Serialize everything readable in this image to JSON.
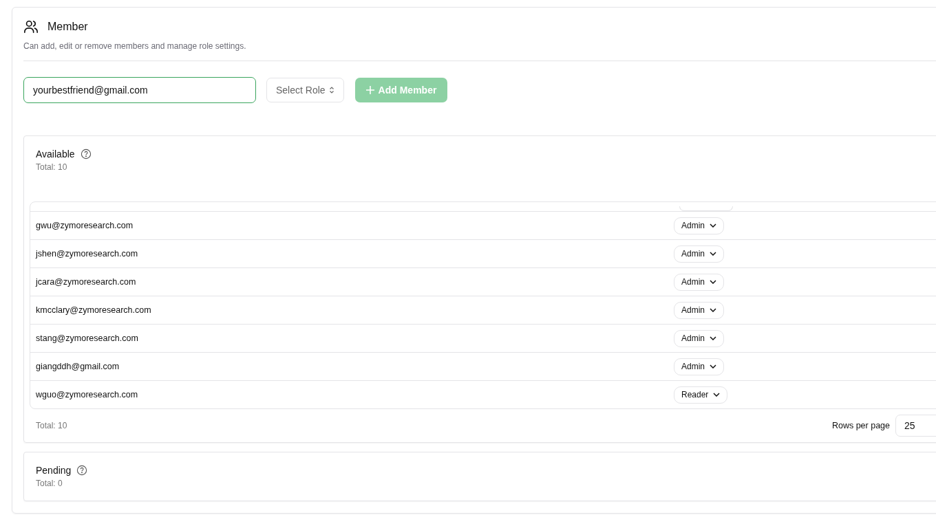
{
  "header": {
    "title": "Member",
    "subtitle": "Can add, edit or remove members and manage role settings."
  },
  "invite": {
    "email": "yourbestfriend@gmail.com",
    "role_placeholder": "Select Role",
    "add_button": "Add Member",
    "add_disabled": true
  },
  "available": {
    "title": "Available",
    "total": "Total: 10",
    "rows": [
      {
        "email": "gwu@zymoresearch.com",
        "role": "Admin"
      },
      {
        "email": "jshen@zymoresearch.com",
        "role": "Admin"
      },
      {
        "email": "jcara@zymoresearch.com",
        "role": "Admin"
      },
      {
        "email": "kmcclary@zymoresearch.com",
        "role": "Admin"
      },
      {
        "email": "stang@zymoresearch.com",
        "role": "Admin"
      },
      {
        "email": "giangddh@gmail.com",
        "role": "Admin"
      },
      {
        "email": "wguo@zymoresearch.com",
        "role": "Reader"
      }
    ],
    "footer_total": "Total: 10",
    "rows_per_page_label": "Rows per page",
    "rows_per_page": "25"
  },
  "pending": {
    "title": "Pending",
    "total": "Total: 0"
  }
}
